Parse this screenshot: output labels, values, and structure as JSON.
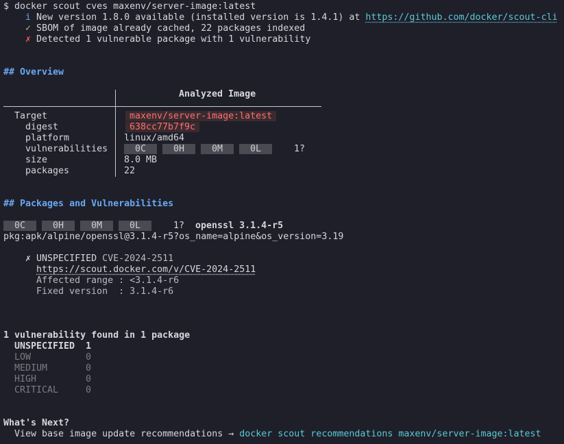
{
  "command": "$ docker scout cves maxenv/server-image:latest",
  "info": {
    "new_version_icon": "i",
    "new_version_text": " New version 1.8.0 available (installed version is 1.4.1) at ",
    "new_version_link": "https://github.com/docker/scout-cli",
    "sbom_icon": "✓",
    "sbom_text": " SBOM of image already cached, 22 packages indexed",
    "detected_icon": "✗",
    "detected_text": " Detected 1 vulnerable package with 1 vulnerability"
  },
  "overview": {
    "heading": "## Overview",
    "column_header": "Analyzed Image",
    "target_label": "Target",
    "target_value": "maxenv/server-image:latest",
    "digest_label": "digest",
    "digest_value": "638cc77b7f9c",
    "platform_label": "platform",
    "platform_value": "linux/amd64",
    "vulnerabilities_label": "vulnerabilities",
    "severity_badges": [
      "0C",
      "0H",
      "0M",
      "0L"
    ],
    "unspecified_count": "1?",
    "size_label": "size",
    "size_value": "8.0 MB",
    "packages_label": "packages",
    "packages_value": "22"
  },
  "packages_section": {
    "heading": "## Packages and Vulnerabilities",
    "severity_badges": [
      "0C",
      "0H",
      "0M",
      "0L"
    ],
    "unspecified_count": "1?",
    "package_name": "openssl 3.1.4-r5",
    "purl": "pkg:apk/alpine/openssl@3.1.4-r5?os_name=alpine&os_version=3.19",
    "vuln_icon": "✗",
    "vuln_severity": "UNSPECIFIED",
    "vuln_id": "CVE-2024-2511",
    "vuln_link": "https://scout.docker.com/v/CVE-2024-2511",
    "affected_range": "Affected range : <3.1.4-r6",
    "fixed_version": "Fixed version  : 3.1.4-r6"
  },
  "summary": {
    "title": "1 vulnerability found in 1 package",
    "rows": [
      {
        "label": "UNSPECIFIED",
        "count": "1"
      },
      {
        "label": "LOW",
        "count": "0"
      },
      {
        "label": "MEDIUM",
        "count": "0"
      },
      {
        "label": "HIGH",
        "count": "0"
      },
      {
        "label": "CRITICAL",
        "count": "0"
      }
    ]
  },
  "next": {
    "title": "What's Next?",
    "text": "View base image update recommendations → ",
    "command": "docker scout recommendations maxenv/server-image:latest"
  },
  "colors": {
    "background": "#1e1f29",
    "foreground": "#d6d7dc",
    "accent_cyan": "#5cc8d8",
    "heading_blue": "#6aa7f2",
    "error_red": "#ff5c57",
    "success_green": "#9ad08a"
  }
}
